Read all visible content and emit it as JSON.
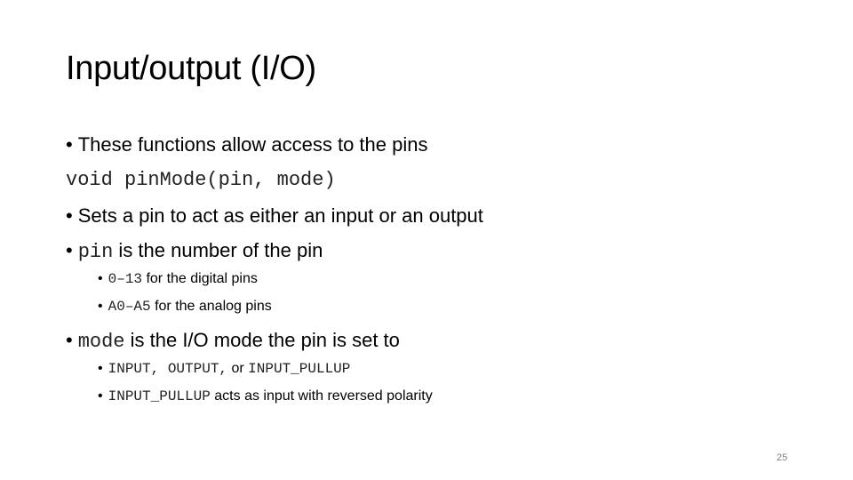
{
  "slide": {
    "title": "Input/output (I/O)",
    "page_number": "25",
    "bullet_glyph": "•",
    "lines": {
      "l1": {
        "text": "These functions allow access to the pins"
      },
      "l2": {
        "code": "void pinMode(pin, mode)"
      },
      "l3": {
        "text": "Sets a pin to act as either an input or an output"
      },
      "l4": {
        "code": "pin",
        "text": " is the number of the pin"
      },
      "l5": {
        "code": "0–13",
        "text": " for the digital pins"
      },
      "l6": {
        "code": "A0–A5",
        "text": " for the analog pins"
      },
      "l7": {
        "code": "mode",
        "text": " is the I/O mode the pin is set to"
      },
      "l8": {
        "code1": "INPUT, OUTPUT,",
        "text": " or ",
        "code2": "INPUT_PULLUP"
      },
      "l9": {
        "code": "INPUT_PULLUP",
        "text": " acts as input with reversed polarity"
      }
    }
  }
}
